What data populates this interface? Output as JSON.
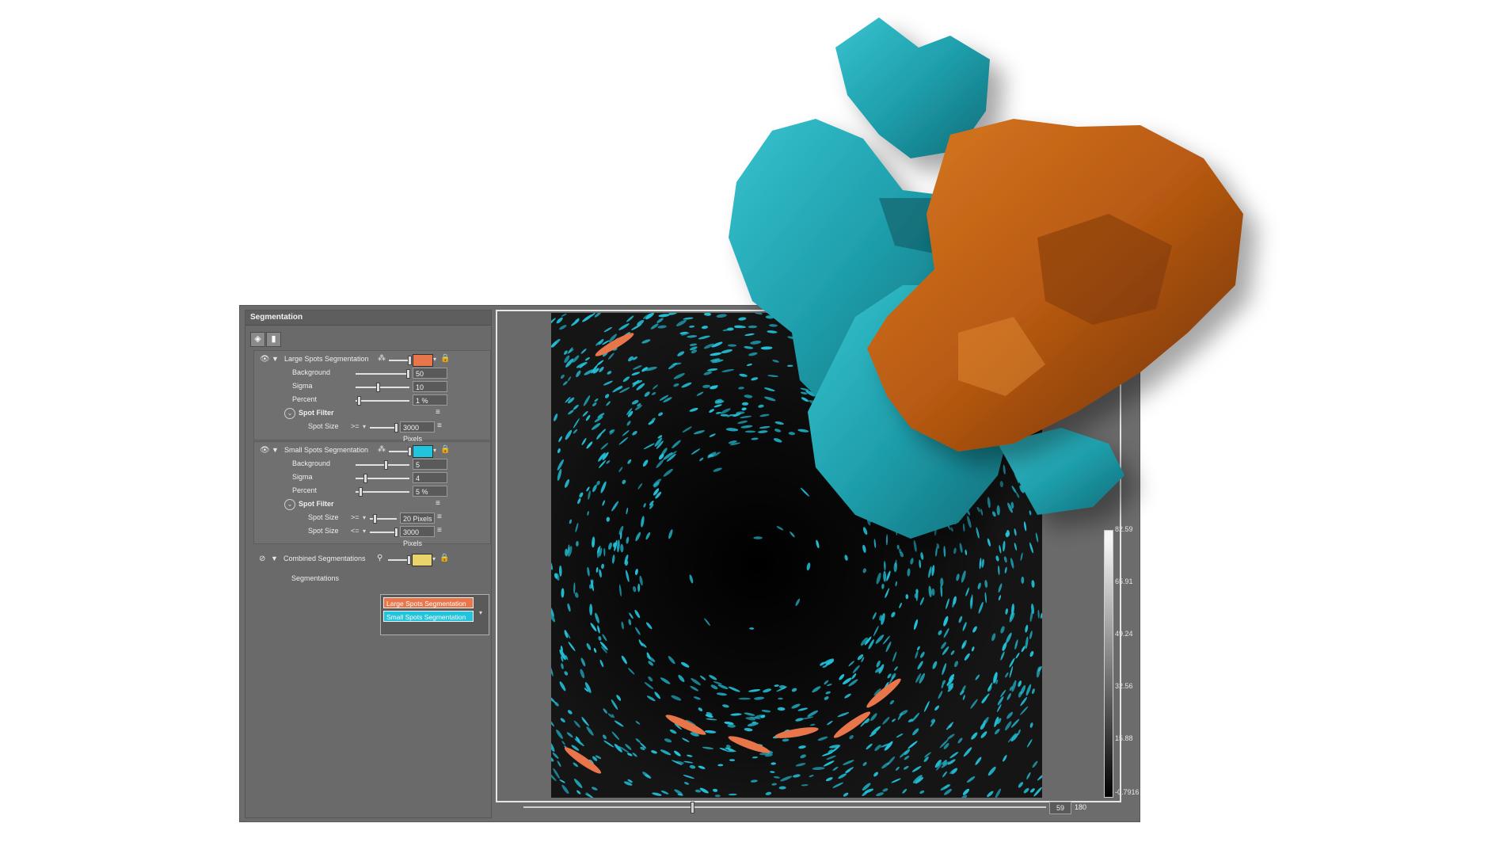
{
  "panel": {
    "title": "Segmentation",
    "toolbar": {
      "add_icon": "layers-icon",
      "delete_icon": "trash-icon"
    }
  },
  "colors": {
    "large_spots": "#e8764a",
    "small_spots": "#22c3dc",
    "combined": "#e8d46a",
    "mesh_cyan": "#1f9fac",
    "mesh_orange": "#b85a12"
  },
  "large": {
    "title": "Large Spots Segmentation",
    "background_label": "Background",
    "background_value": "50",
    "sigma_label": "Sigma",
    "sigma_value": "10",
    "percent_label": "Percent",
    "percent_value": "1 %",
    "filter_label": "Spot Filter",
    "spot_size_label": "Spot Size",
    "spot_size_op": ">=",
    "spot_size_value": "3000 Pixels"
  },
  "small": {
    "title": "Small Spots Segmentation",
    "background_label": "Background",
    "background_value": "5",
    "sigma_label": "Sigma",
    "sigma_value": "4",
    "percent_label": "Percent",
    "percent_value": "5 %",
    "filter_label": "Spot Filter",
    "spot_size1_label": "Spot Size",
    "spot_size1_op": ">=",
    "spot_size1_value": "20 Pixels",
    "spot_size2_label": "Spot Size",
    "spot_size2_op": "<=",
    "spot_size2_value": "3000 Pixels"
  },
  "combined": {
    "title": "Combined Segmentations",
    "segmentations_label": "Segmentations",
    "items": [
      "Large Spots Segmentation",
      "Small Spots Segmentation"
    ]
  },
  "colorbar": {
    "ticks": [
      "82.59",
      "65.91",
      "49.24",
      "32.56",
      "15.88",
      "-0.7916"
    ]
  },
  "frame": {
    "current": "59",
    "max": "180"
  }
}
